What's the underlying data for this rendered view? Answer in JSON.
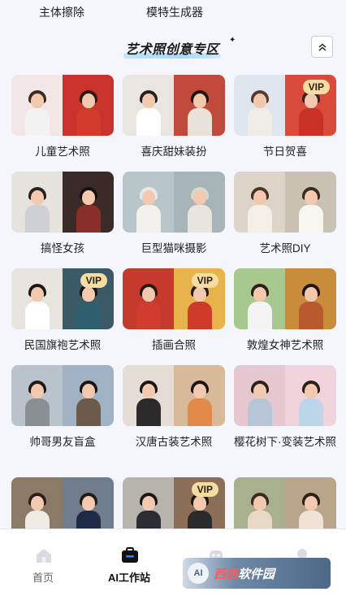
{
  "top_tools": [
    "主体擦除",
    "模特生成器"
  ],
  "section": {
    "title": "艺术照创意专区"
  },
  "vip_label": "VIP",
  "cards": [
    {
      "label": "儿童艺术照",
      "vip": false,
      "bg": [
        "#f3e6e6",
        "#c8342b"
      ],
      "body": [
        "#f2f2f2",
        "#d23a2c"
      ],
      "hair": [
        "#3a2a22",
        "#2a1c18"
      ]
    },
    {
      "label": "喜庆甜妹装扮",
      "vip": false,
      "bg": [
        "#e9e5e1",
        "#c04a3c"
      ],
      "body": [
        "#ffffff",
        "#e8e2d8"
      ],
      "hair": [
        "#2b1f1b",
        "#1e1613"
      ]
    },
    {
      "label": "节日贺喜",
      "vip": true,
      "bg": [
        "#dfe6ee",
        "#d84a3a"
      ],
      "body": [
        "#f0ede8",
        "#c93127"
      ],
      "hair": [
        "#5a3a2a",
        "#3b2420"
      ]
    },
    {
      "label": "搞怪女孩",
      "vip": false,
      "bg": [
        "#e6e2dd",
        "#3a2a28"
      ],
      "body": [
        "#cfd0d4",
        "#8a2e2a"
      ],
      "hair": [
        "#2a211d",
        "#151010"
      ]
    },
    {
      "label": "巨型猫咪摄影",
      "vip": false,
      "bg": [
        "#b9c6c9",
        "#a7b5b9"
      ],
      "body": [
        "#f3f1ee",
        "#e8e5df"
      ],
      "hair": [
        "#ebe8e2",
        "#d9d5cf"
      ]
    },
    {
      "label": "艺术照DIY",
      "vip": false,
      "bg": [
        "#dcd4c6",
        "#c9c1b2"
      ],
      "body": [
        "#f4f0e8",
        "#f7f5f0"
      ],
      "hair": [
        "#4b3325",
        "#3a2a20"
      ]
    },
    {
      "label": "民国旗袍艺术照",
      "vip": true,
      "bg": [
        "#e8e4df",
        "#3c5a66"
      ],
      "body": [
        "#ffffff",
        "#2d5f6f"
      ],
      "hair": [
        "#1f1715",
        "#1a1413"
      ]
    },
    {
      "label": "插画合照",
      "vip": true,
      "bg": [
        "#c43a2c",
        "#e7b34a"
      ],
      "body": [
        "#d23c2e",
        "#cf3a2b"
      ],
      "hair": [
        "#2a1a16",
        "#2a1a16"
      ]
    },
    {
      "label": "敦煌女神艺术照",
      "vip": false,
      "bg": [
        "#a8c98e",
        "#c88c3a"
      ],
      "body": [
        "#f4f4f4",
        "#b95a2e"
      ],
      "hair": [
        "#2a1f1a",
        "#1e1612"
      ]
    },
    {
      "label": "帅哥男友盲盒",
      "vip": false,
      "bg": [
        "#b9c3cb",
        "#9fb3c4"
      ],
      "body": [
        "#8a8f93",
        "#6e5a4a"
      ],
      "hair": [
        "#1e1a18",
        "#1a1614"
      ]
    },
    {
      "label": "汉唐古装艺术照",
      "vip": false,
      "bg": [
        "#e3ddd6",
        "#d8b99a"
      ],
      "body": [
        "#2b2b2b",
        "#e28a4a"
      ],
      "hair": [
        "#1c1614",
        "#1a1412"
      ]
    },
    {
      "label": "樱花树下·变装艺术照",
      "vip": false,
      "bg": [
        "#e6c7d0",
        "#f1d3dc"
      ],
      "body": [
        "#b7c6d6",
        "#bcd5e8"
      ],
      "hair": [
        "#2a1f1b",
        "#2a1f1b"
      ]
    },
    {
      "label": "",
      "vip": false,
      "bg": [
        "#8b7a66",
        "#6f7d8c"
      ],
      "body": [
        "#efeae2",
        "#1f2b46"
      ],
      "hair": [
        "#2b211c",
        "#241b17"
      ]
    },
    {
      "label": "",
      "vip": true,
      "bg": [
        "#b7b3ad",
        "#8a6e57"
      ],
      "body": [
        "#2b2d33",
        "#2b2b2b"
      ],
      "hair": [
        "#1e1815",
        "#1e1815"
      ]
    },
    {
      "label": "",
      "vip": false,
      "bg": [
        "#a8b08e",
        "#b9a58a"
      ],
      "body": [
        "#e9d8c8",
        "#f0e2d4"
      ],
      "hair": [
        "#3b2a20",
        "#2f2019"
      ]
    }
  ],
  "nav": [
    {
      "label": "首页",
      "icon": "home-icon",
      "active": false
    },
    {
      "label": "AI工作站",
      "icon": "briefcase-icon",
      "active": true
    },
    {
      "label": "",
      "icon": "robot-icon",
      "active": false
    },
    {
      "label": "",
      "icon": "profile-icon",
      "active": false
    }
  ],
  "watermark": {
    "badge": "AI",
    "text_a": "西西",
    "text_b": "软件园"
  },
  "colors": {
    "accent": "#0a74ff",
    "background": "#f4f6fb",
    "vip_bg": "#f4dca3"
  }
}
